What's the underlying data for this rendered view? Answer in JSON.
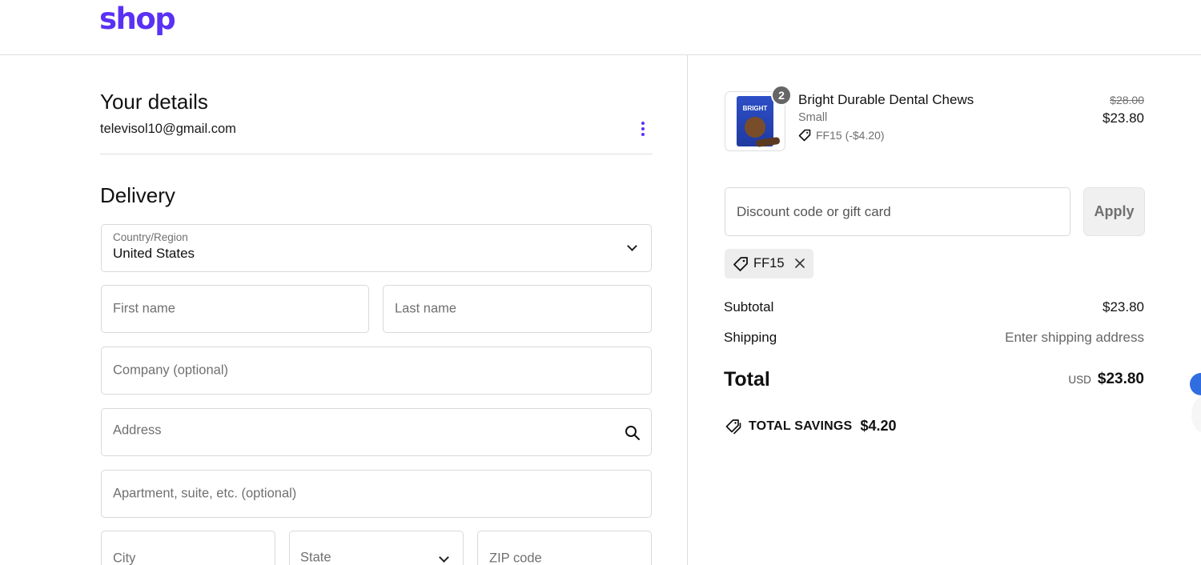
{
  "brand": {
    "logo_text": "shop",
    "logo_color": "#5a31f4"
  },
  "details": {
    "heading": "Your details",
    "email": "televisol10@gmail.com"
  },
  "delivery": {
    "heading": "Delivery",
    "country": {
      "label": "Country/Region",
      "value": "United States"
    },
    "first_name": {
      "placeholder": "First name"
    },
    "last_name": {
      "placeholder": "Last name"
    },
    "company": {
      "placeholder": "Company (optional)"
    },
    "address": {
      "placeholder": "Address"
    },
    "apartment": {
      "placeholder": "Apartment, suite, etc. (optional)"
    },
    "city": {
      "placeholder": "City"
    },
    "state": {
      "placeholder": "State"
    },
    "zip": {
      "placeholder": "ZIP code"
    }
  },
  "order": {
    "item": {
      "quantity": "2",
      "name": "Bright Durable Dental Chews",
      "variant": "Small",
      "discount": "FF15 (-$4.20)",
      "price_original": "$28.00",
      "price_final": "$23.80",
      "thumb_text": "BRIGHT"
    },
    "discount_field": {
      "placeholder": "Discount code or gift card"
    },
    "apply_label": "Apply",
    "applied_code": "FF15",
    "subtotal": {
      "label": "Subtotal",
      "value": "$23.80"
    },
    "shipping": {
      "label": "Shipping",
      "value": "Enter shipping address"
    },
    "total": {
      "label": "Total",
      "currency": "USD",
      "value": "$23.80"
    },
    "savings": {
      "label": "TOTAL SAVINGS",
      "value": "$4.20"
    }
  },
  "icons": [
    "more-options-icon",
    "chevron-down-icon",
    "search-icon",
    "tag-icon",
    "close-icon",
    "savings-tag-icon"
  ]
}
